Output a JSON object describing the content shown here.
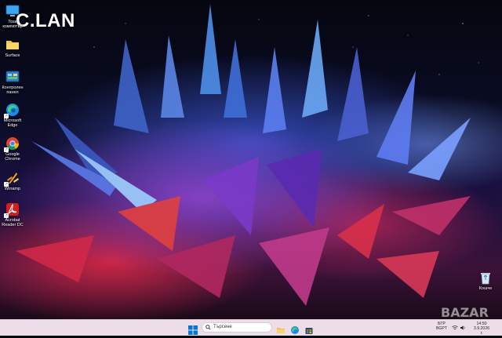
{
  "brand": {
    "text": "C.LAN"
  },
  "desktop_icons": [
    {
      "label": "Този компютър",
      "icon": "this-pc-icon"
    },
    {
      "label": "Surface",
      "icon": "folder-icon"
    },
    {
      "label": "Контролен панел",
      "icon": "control-panel-icon"
    },
    {
      "label": "Microsoft Edge",
      "icon": "edge-icon"
    },
    {
      "label": "Google Chrome",
      "icon": "chrome-icon"
    },
    {
      "label": "Winamp",
      "icon": "winamp-icon"
    },
    {
      "label": "Acrobat Reader DC",
      "icon": "acrobat-icon"
    },
    {
      "label": "Кошче",
      "icon": "recycle-bin-icon"
    }
  ],
  "taskbar": {
    "search_placeholder": "Търсене",
    "apps": [
      "file-explorer-icon",
      "edge-icon",
      "store-icon"
    ],
    "language": "БГР",
    "language_sub": "BGPT",
    "time": "14:50",
    "date": "3.9.2026 г."
  },
  "watermark": {
    "text": "BAZAR"
  },
  "colors": {
    "taskbar_bg": "#ecdde8",
    "accent": "#0078d4"
  }
}
